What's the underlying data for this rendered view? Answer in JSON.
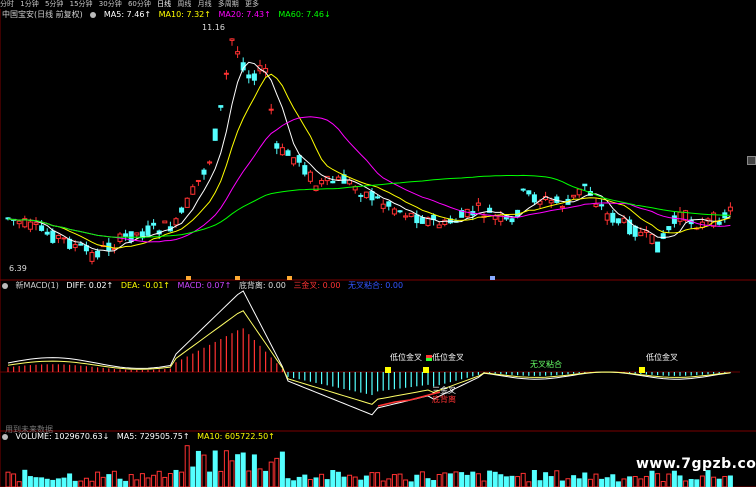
{
  "toolbar": {
    "items": [
      "分时",
      "1分钟",
      "5分钟",
      "15分钟",
      "30分钟",
      "60分钟",
      "日线",
      "周线",
      "月线",
      "多周期",
      "更多"
    ],
    "active_index": 6
  },
  "main_legend": {
    "title": "中国宝安(日线 前复权)",
    "ma5": "MA5: 7.46↑",
    "ma10": "MA10: 7.32↑",
    "ma20": "MA20: 7.43↑",
    "ma60": "MA60: 7.46↓"
  },
  "price_labels": {
    "high": "11.16",
    "low": "6.39"
  },
  "macd_legend": {
    "name": "新MACD(1)",
    "diff": "DIFF: 0.02↑",
    "dea": "DEA: -0.01↑",
    "macd": "MACD: 0.07↑",
    "bottom_div": "底背离: 0.00",
    "triple_gold": "三金叉: 0.00",
    "no_cross": "无叉粘合: 0.00"
  },
  "macd_annotations": [
    "低位金叉",
    "低位金叉",
    "低位金叉",
    "无叉粘合",
    "三金叉",
    "底背离"
  ],
  "hint": "用到未来数据",
  "volume_legend": {
    "volume": "VOLUME: 1029670.63↓",
    "ma5": "MA5: 729505.75↑",
    "ma10": "MA10: 605722.50↑"
  },
  "watermark": "www.7gpzb.com",
  "colors": {
    "up": "#ff3232",
    "down": "#54ffff",
    "ma5": "#ffffff",
    "ma10": "#ffff00",
    "ma20": "#ff00ff",
    "ma60": "#00ff00",
    "macd_text": "#cc44ff",
    "triple_gold": "#ff3333",
    "no_cross": "#3355ff",
    "bar_pos": "#ff3232",
    "bar_neg": "#54ffff"
  }
}
